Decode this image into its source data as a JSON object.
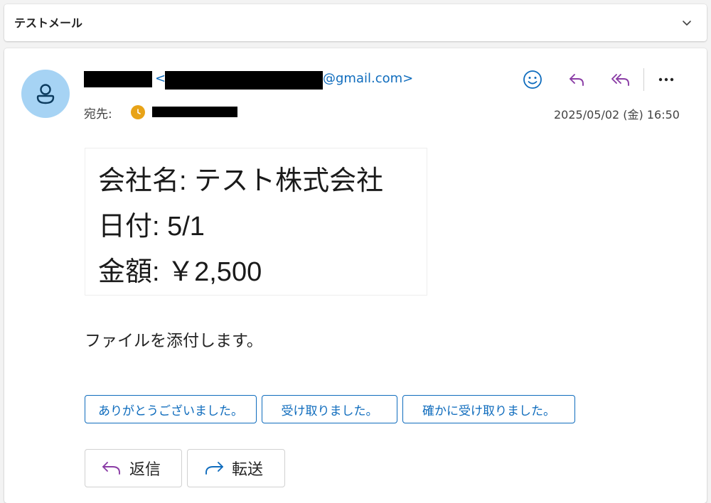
{
  "subject": {
    "title": "テストメール"
  },
  "header": {
    "sender_open": "<",
    "sender_domain": "@gmail.com>",
    "to_label": "宛先:",
    "date": "2025/05/02 (金) 16:50"
  },
  "body": {
    "lines": [
      "会社名: テスト株式会社",
      "日付: 5/1",
      "金額: ￥2,500"
    ],
    "attachment_note": "ファイルを添付します。"
  },
  "suggested_replies": [
    "ありがとうございました。",
    "受け取りました。",
    "確かに受け取りました。"
  ],
  "actions": {
    "reply": "返信",
    "forward": "転送"
  },
  "colors": {
    "accent": "#0f6cbd",
    "reply_icon": "#8a3ca5",
    "avatar_bg": "#a6d3f4",
    "clock": "#e8a317"
  }
}
